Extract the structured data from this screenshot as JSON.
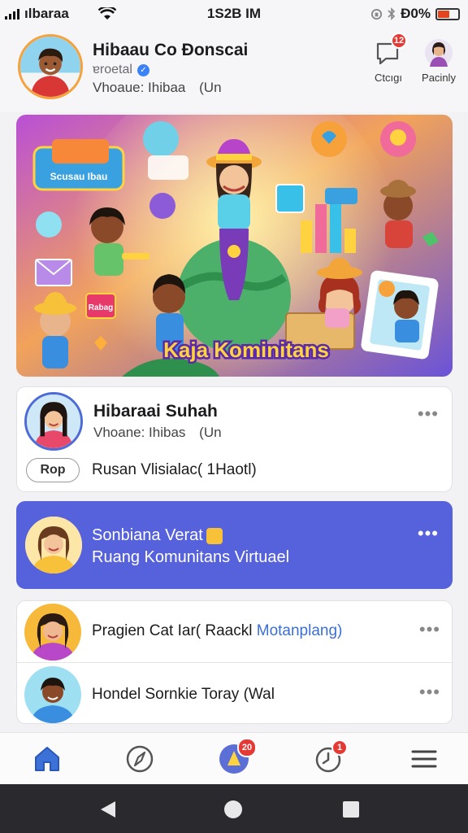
{
  "status_bar": {
    "carrier": "ılbaraa",
    "time": "1S2B IM",
    "battery_text": "Ð0%"
  },
  "header": {
    "title": "Hibaau Co Ðonscai",
    "subtitle": "ɐroetal",
    "meta": "Vhoaue: Ihibaa",
    "meta_icon": "(Un",
    "actions": [
      {
        "label": "Ctcıgı",
        "icon": "chat-icon",
        "badge": "12"
      },
      {
        "label": "Pacinly",
        "icon": "profile-icon"
      }
    ]
  },
  "banner": {
    "title": "Kaja Kominitans",
    "sign": "Scusau Ibau",
    "board": "Rabag"
  },
  "posts": [
    {
      "name": "Hibaraai Suhah",
      "meta": "Vhoane: Ihibas",
      "meta_icon": "(Un",
      "reply_button": "Rop",
      "text": "Rusan Vlisialac( 1Haotl)"
    },
    {
      "title": "Sonbiana Verat",
      "subtitle": "Ruang Komunitans Virtuael"
    },
    {
      "text": "Pragien Cat Iar( Raackl",
      "link": "Motanplang)"
    },
    {
      "text": "Hondel Sornkie Toray (Wal"
    }
  ],
  "bottom_nav": [
    {
      "icon": "home-icon",
      "active": true
    },
    {
      "icon": "compass-icon"
    },
    {
      "icon": "create-icon",
      "badge": "20"
    },
    {
      "icon": "notifications-icon",
      "badge": "1"
    },
    {
      "icon": "menu-icon"
    }
  ],
  "colors": {
    "accent": "#5661dc",
    "badge": "#e53935",
    "home": "#3c72d8"
  }
}
